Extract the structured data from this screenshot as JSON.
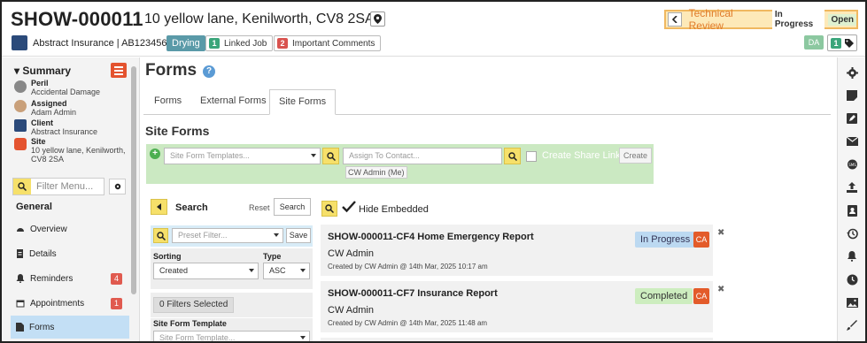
{
  "header": {
    "job_id": "SHOW-000011",
    "address": "10 yellow lane, Kenilworth, CV8 2SA",
    "client_line": "Abstract Insurance | AB123456",
    "badge_drying": "Drying",
    "linked_job": {
      "count": "1",
      "label": "Linked Job"
    },
    "important_comments": {
      "count": "2",
      "label": "Important Comments"
    },
    "status": {
      "name": "Technical Review",
      "progress": "In Progress",
      "open": "Open"
    },
    "initials": "DA",
    "tag_count": "1"
  },
  "sidebar": {
    "summary_title": "Summary",
    "summary": [
      {
        "label": "Peril",
        "value": "Accidental Damage"
      },
      {
        "label": "Assigned",
        "value": "Adam Admin"
      },
      {
        "label": "Client",
        "value": "Abstract Insurance"
      },
      {
        "label": "Site",
        "value": "10 yellow lane, Kenilworth,",
        "value2": "CV8 2SA"
      }
    ],
    "filter_placeholder": "Filter Menu...",
    "nav_heading": "General",
    "nav": [
      {
        "label": "Overview",
        "icon": "tachometer-icon"
      },
      {
        "label": "Details",
        "icon": "document-icon"
      },
      {
        "label": "Reminders",
        "icon": "bell-icon",
        "count": "4"
      },
      {
        "label": "Appointments",
        "icon": "calendar-icon",
        "count": "1"
      },
      {
        "label": "Forms",
        "icon": "file-icon"
      }
    ]
  },
  "main": {
    "title": "Forms",
    "tabs": [
      "Forms",
      "External Forms",
      "Site Forms"
    ],
    "active_tab": "Site Forms",
    "section_title": "Site Forms",
    "template_placeholder": "Site Form Templates...",
    "assign_placeholder": "Assign To Contact...",
    "share_link_label": "Create Share Link",
    "create_label": "Create",
    "assign_tag": "CW Admin (Me)"
  },
  "filters": {
    "search_label": "Search",
    "reset_label": "Reset",
    "search_button": "Search",
    "preset_placeholder": "Preset Filter...",
    "save_button": "Save",
    "sorting_label": "Sorting",
    "sorting_value": "Created",
    "type_label": "Type",
    "type_value": "ASC",
    "filters_selected": "0 Filters Selected",
    "template_label": "Site Form Template",
    "template_placeholder": "Site Form Template..."
  },
  "list": {
    "hide_embedded": "Hide Embedded",
    "items": [
      {
        "title": "SHOW-000011-CF4 Home Emergency Report",
        "status": "In Progress",
        "assignee": "CW Admin",
        "meta": "Created by CW Admin @ 14th Mar, 2025 10:17 am",
        "initials": "CA"
      },
      {
        "title": "SHOW-000011-CF7 Insurance Report",
        "status": "Completed",
        "assignee": "CW Admin",
        "meta": "Created by CW Admin @ 14th Mar, 2025 11:48 am",
        "initials": "CA"
      }
    ]
  },
  "rail_icons": [
    "gear-icon",
    "note-icon",
    "edit-icon",
    "mail-icon",
    "sms-icon",
    "upload-icon",
    "contact-icon",
    "history-icon",
    "bell-icon",
    "clock-icon",
    "image-icon",
    "brush-icon"
  ],
  "colors": {
    "accent_orange": "#e4532f",
    "status_border": "#f0b860",
    "status_bg": "#fde9b8",
    "active_nav": "#c3dff5",
    "green_panel": "#cbe9c2",
    "search_yellow": "#f6e06a"
  }
}
